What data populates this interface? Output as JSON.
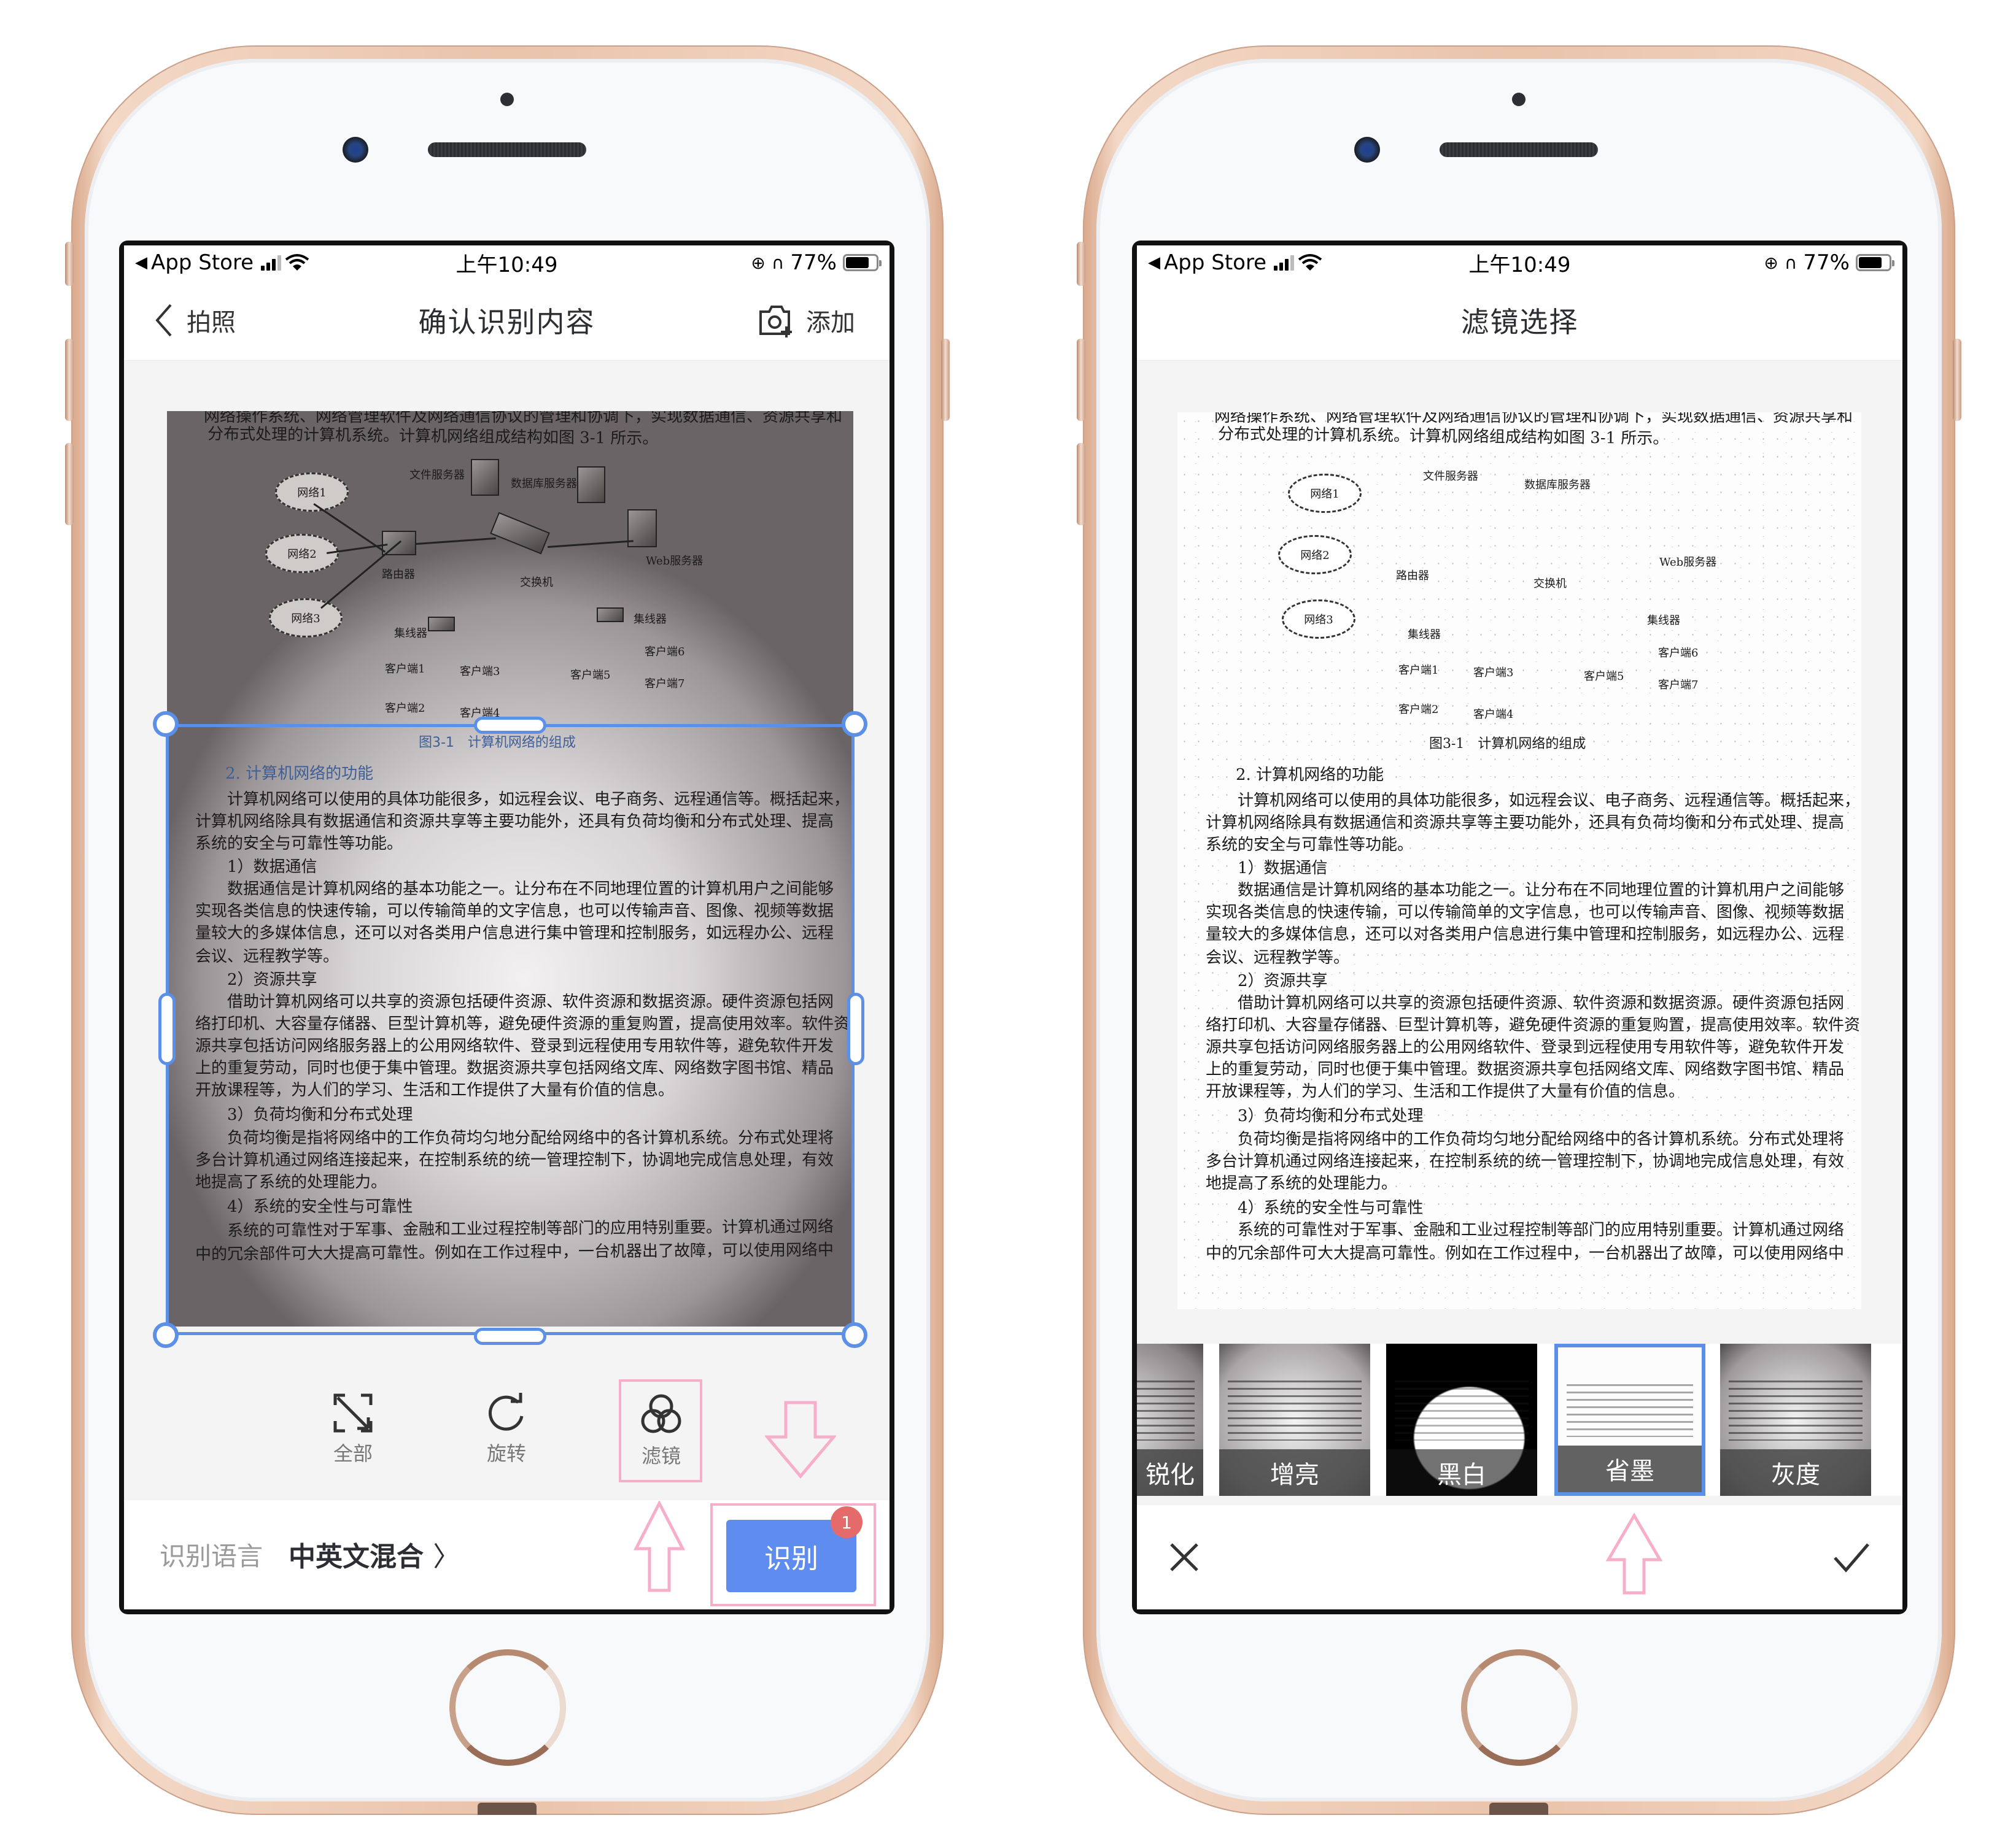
{
  "status_bar": {
    "back_app": "App Store",
    "time": "上午10:49",
    "battery": "77%",
    "battery_level": 0.77
  },
  "left_phone": {
    "nav": {
      "back_label": "拍照",
      "title": "确认识别内容",
      "add_label": "添加"
    },
    "tools": [
      {
        "label": "全部",
        "icon": "expand-icon"
      },
      {
        "label": "旋转",
        "icon": "rotate-icon"
      },
      {
        "label": "滤镜",
        "icon": "filter-icon"
      }
    ],
    "bottom": {
      "language_label": "识别语言",
      "language_value": "中英文混合",
      "recognize_button": "识别",
      "badge_count": "1"
    }
  },
  "right_phone": {
    "nav": {
      "title": "滤镜选择"
    },
    "filters": [
      {
        "label": "锐化",
        "selected": false
      },
      {
        "label": "增亮",
        "selected": false
      },
      {
        "label": "黑白",
        "selected": false
      },
      {
        "label": "省墨",
        "selected": true
      },
      {
        "label": "灰度",
        "selected": false
      }
    ],
    "cancel_icon": "close-icon",
    "confirm_icon": "check-icon"
  },
  "document": {
    "intro_lines": [
      "网络操作系统、网络管理软件及网络通信协议的管理和协调下，实现数据通信、资源共享和",
      "分布式处理的计算机系统。计算机网络组成结构如图 3-1 所示。"
    ],
    "diagram": {
      "networks": [
        "网络1",
        "网络2",
        "网络3"
      ],
      "router": "路由器",
      "switch": "交换机",
      "file_server": "文件服务器",
      "db_server": "数据库服务器",
      "web_server": "Web服务器",
      "hub_left": "集线器",
      "hub_right": "集线器",
      "clients": [
        "客户端1",
        "客户端2",
        "客户端3",
        "客户端4",
        "客户端5",
        "客户端6",
        "客户端7"
      ]
    },
    "caption": "图3-1　计算机网络的组成",
    "section_heading": "2.  计算机网络的功能",
    "lines": [
      "　　计算机网络可以使用的具体功能很多，如远程会议、电子商务、远程通信等。概括起来，",
      "计算机网络除具有数据通信和资源共享等主要功能外，还具有负荷均衡和分布式处理、提高",
      "系统的安全与可靠性等功能。",
      "　　1）数据通信",
      "　　数据通信是计算机网络的基本功能之一。让分布在不同地理位置的计算机用户之间能够",
      "实现各类信息的快速传输，可以传输简单的文字信息，也可以传输声音、图像、视频等数据",
      "量较大的多媒体信息，还可以对各类用户信息进行集中管理和控制服务，如远程办公、远程",
      "会议、远程教学等。",
      "　　2）资源共享",
      "　　借助计算机网络可以共享的资源包括硬件资源、软件资源和数据资源。硬件资源包括网",
      "络打印机、大容量存储器、巨型计算机等，避免硬件资源的重复购置，提高使用效率。软件资",
      "源共享包括访问网络服务器上的公用网络软件、登录到远程使用专用软件等，避免软件开发",
      "上的重复劳动，同时也便于集中管理。数据资源共享包括网络文库、网络数字图书馆、精品",
      "开放课程等，为人们的学习、生活和工作提供了大量有价值的信息。",
      "　　3）负荷均衡和分布式处理",
      "　　负荷均衡是指将网络中的工作负荷均匀地分配给网络中的各计算机系统。分布式处理将",
      "多台计算机通过网络连接起来，在控制系统的统一管理控制下，协调地完成信息处理，有效",
      "地提高了系统的处理能力。",
      "　　4）系统的安全性与可靠性",
      "　　系统的可靠性对于军事、金融和工业过程控制等部门的应用特别重要。计算机通过网络",
      "中的冗余部件可大大提高可靠性。例如在工作过程中，一台机器出了故障，可以使用网络中"
    ]
  },
  "colors": {
    "accent": "#5f8def",
    "crop_frame": "#5b8fe8",
    "badge": "#e56a6a",
    "annotation": "#f6aecb",
    "phone_gold": "#e9c3aa"
  }
}
